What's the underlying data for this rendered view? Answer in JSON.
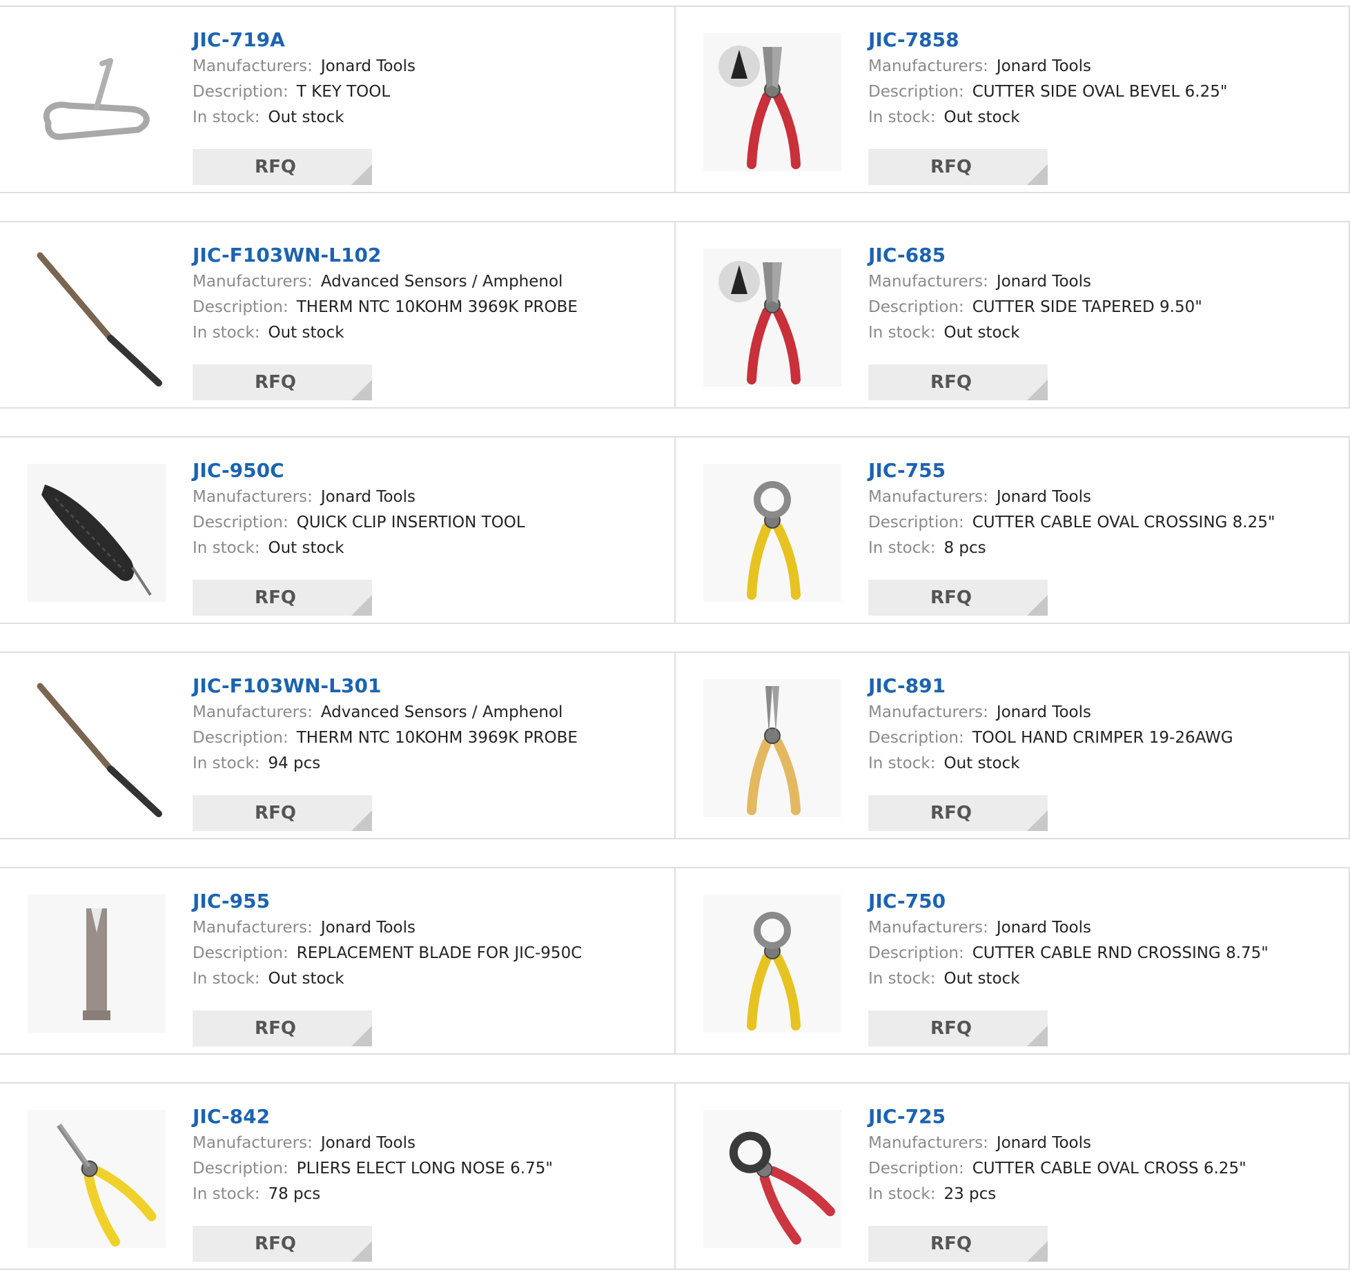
{
  "labels": {
    "manufacturer": "Manufacturers:",
    "description": "Description:",
    "stock": "In stock:",
    "rfq": "RFQ"
  },
  "products": [
    {
      "part": "JIC-719A",
      "manufacturer": "Jonard Tools",
      "description": "T KEY TOOL",
      "stock": "Out stock",
      "image": "t-key-tool-icon"
    },
    {
      "part": "JIC-7858",
      "manufacturer": "Jonard Tools",
      "description": "CUTTER SIDE OVAL BEVEL 6.25\"",
      "stock": "Out stock",
      "image": "side-cutter-red-icon"
    },
    {
      "part": "JIC-F103WN-L102",
      "manufacturer": "Advanced Sensors / Amphenol",
      "description": "THERM NTC 10KOHM 3969K PROBE",
      "stock": "Out stock",
      "image": "thermistor-probe-icon"
    },
    {
      "part": "JIC-685",
      "manufacturer": "Jonard Tools",
      "description": "CUTTER SIDE TAPERED 9.50\"",
      "stock": "Out stock",
      "image": "side-cutter-red-icon"
    },
    {
      "part": "JIC-950C",
      "manufacturer": "Jonard Tools",
      "description": "QUICK CLIP INSERTION TOOL",
      "stock": "Out stock",
      "image": "insertion-tool-icon"
    },
    {
      "part": "JIC-755",
      "manufacturer": "Jonard Tools",
      "description": "CUTTER CABLE OVAL CROSSING 8.25\"",
      "stock": "8 pcs",
      "image": "cable-cutter-yellow-icon"
    },
    {
      "part": "JIC-F103WN-L301",
      "manufacturer": "Advanced Sensors / Amphenol",
      "description": "THERM NTC 10KOHM 3969K PROBE",
      "stock": "94 pcs",
      "image": "thermistor-probe-icon"
    },
    {
      "part": "JIC-891",
      "manufacturer": "Jonard Tools",
      "description": "TOOL HAND CRIMPER 19-26AWG",
      "stock": "Out stock",
      "image": "crimper-tan-icon"
    },
    {
      "part": "JIC-955",
      "manufacturer": "Jonard Tools",
      "description": "REPLACEMENT BLADE FOR JIC-950C",
      "stock": "Out stock",
      "image": "replacement-blade-icon"
    },
    {
      "part": "JIC-750",
      "manufacturer": "Jonard Tools",
      "description": "CUTTER CABLE RND CROSSING 8.75\"",
      "stock": "Out stock",
      "image": "cable-cutter-yellow-icon"
    },
    {
      "part": "JIC-842",
      "manufacturer": "Jonard Tools",
      "description": "PLIERS ELECT LONG NOSE 6.75\"",
      "stock": "78 pcs",
      "image": "long-nose-pliers-yellow-icon"
    },
    {
      "part": "JIC-725",
      "manufacturer": "Jonard Tools",
      "description": "CUTTER CABLE OVAL CROSS 6.25\"",
      "stock": "23 pcs",
      "image": "cable-cutter-red-icon"
    }
  ],
  "colors": {
    "link": "#1c63b0",
    "label": "#8a8a8a",
    "value": "#222222",
    "button_bg": "#ececec",
    "border": "#dedede"
  }
}
